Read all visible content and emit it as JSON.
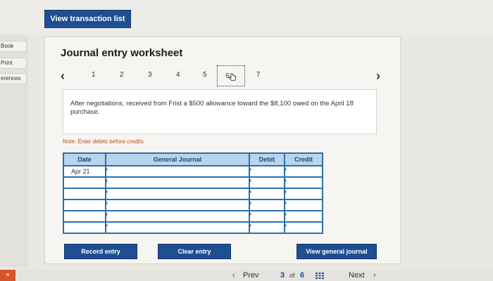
{
  "header": {
    "view_transactions": "View transaction list"
  },
  "left_rail": [
    "Book",
    "Print",
    "erences"
  ],
  "worksheet": {
    "title": "Journal entry worksheet",
    "pages": [
      "1",
      "2",
      "3",
      "4",
      "5",
      "6",
      "7"
    ],
    "active_page": "6",
    "instruction": "After negotiations, received from Frist a $500 allowance toward the $8,100 owed on the April 18 purchase.",
    "note": "Note: Enter debits before credits."
  },
  "table": {
    "headers": {
      "date": "Date",
      "journal": "General Journal",
      "debit": "Debit",
      "credit": "Credit"
    },
    "rows": [
      {
        "date": "Apr 21",
        "journal": "",
        "debit": "",
        "credit": ""
      },
      {
        "date": "",
        "journal": "",
        "debit": "",
        "credit": ""
      },
      {
        "date": "",
        "journal": "",
        "debit": "",
        "credit": ""
      },
      {
        "date": "",
        "journal": "",
        "debit": "",
        "credit": ""
      },
      {
        "date": "",
        "journal": "",
        "debit": "",
        "credit": ""
      },
      {
        "date": "",
        "journal": "",
        "debit": "",
        "credit": ""
      }
    ]
  },
  "buttons": {
    "record": "Record entry",
    "clear": "Clear entry",
    "view_general": "View general journal"
  },
  "footer": {
    "badge": "w",
    "prev": "Prev",
    "current": "3",
    "of": "of",
    "total": "6",
    "next": "Next"
  },
  "colors": {
    "primary_button": "#1d4f91",
    "table_border": "#2f6fa8",
    "table_header": "#b9d4ef",
    "note": "#c24a1c"
  }
}
